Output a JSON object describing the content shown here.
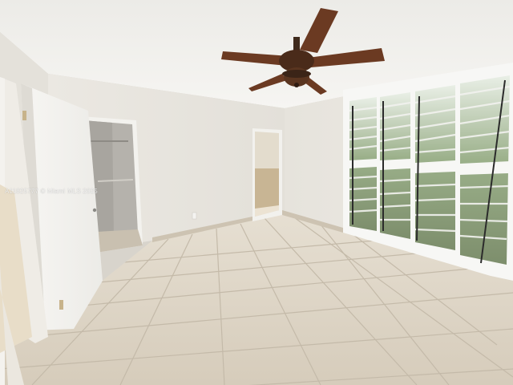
{
  "photo": {
    "watermark": "A11825777 © Miami MLS 2025",
    "colors": {
      "ceiling": "#f1f0ec",
      "wall": "#e9e6df",
      "floor_tile": "#dcd3c4",
      "grout": "#c2b8a8",
      "baseboard": "#c9bfae",
      "fan_blade": "#6b3a22",
      "shutter_frame": "#f7f7f5"
    }
  }
}
